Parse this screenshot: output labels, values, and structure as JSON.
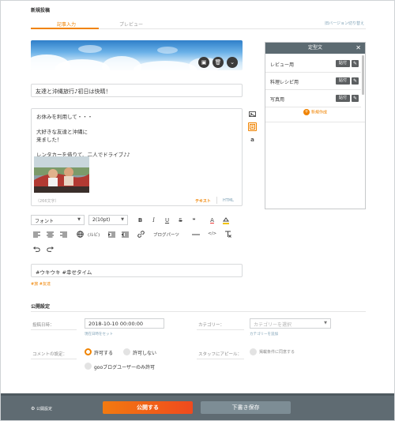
{
  "page": {
    "title": "新規投稿"
  },
  "tabs": [
    {
      "label": "記事入力"
    },
    {
      "label": "プレビュー"
    }
  ],
  "version_switch": "旧バージョン切り替え",
  "header_image": {
    "buttons": [
      {
        "icon": "image-change-icon"
      },
      {
        "icon": "trash-icon"
      },
      {
        "icon": "chevron-down-icon"
      }
    ]
  },
  "title_input": {
    "value": "友達と沖縄旅行♪初日は快晴！"
  },
  "editor": {
    "lines": [
      "お休みを利用して・・・",
      "",
      "大好きな友達と沖縄に",
      "来ました！",
      "",
      "レンタカーを借りて、二人でドライブ♪♪"
    ],
    "char_count": "（266文字）",
    "mode_text": "テキスト",
    "mode_html": "HTML"
  },
  "side_icons": [
    {
      "name": "photo-icon"
    },
    {
      "name": "template-icon"
    },
    {
      "name": "amazon-icon",
      "glyph": "a"
    }
  ],
  "template_panel": {
    "title": "定型文",
    "items": [
      {
        "label": "レビュー用",
        "paste": "貼付"
      },
      {
        "label": "料理レシピ用",
        "paste": "貼付"
      },
      {
        "label": "写真用",
        "paste": "貼付"
      }
    ],
    "new_label": "新規作成"
  },
  "toolbar": {
    "font_select": "フォント",
    "size_select": "2(10pt)",
    "bold": "B",
    "italic": "I",
    "underline": "U",
    "strike": "S",
    "quote": "❝",
    "font_color": "A",
    "ruby": "(ルビ)",
    "blog_parts": "ブログパーツ",
    "html_tag": "</>"
  },
  "tags": {
    "value": "#ウキウキ #幸せタイム",
    "suggestions": "#旅 #友達"
  },
  "publish_settings": {
    "title": "公開設定",
    "date_label": "投稿日時：",
    "date_value": "2018-10-10 00:00:00",
    "date_help": "現在日時をセット",
    "category_label": "カテゴリー：",
    "category_placeholder": "カテゴリーを選択",
    "category_help": "カテゴリーを追加",
    "comment_label": "コメントの設定：",
    "comment_options": [
      {
        "label": "許可する",
        "selected": true
      },
      {
        "label": "許可しない",
        "selected": false
      },
      {
        "label": "gooブログユーザーのみ許可",
        "selected": false
      }
    ],
    "staff_label": "スタッフにアピール：",
    "staff_checkbox": "掲載条件に同意する"
  },
  "footer": {
    "settings": "公開設定",
    "publish": "公開する",
    "draft": "下書き保存"
  },
  "colors": {
    "accent": "#f08300",
    "footer_bg": "#5f6b72",
    "link": "#7b9fb4"
  }
}
